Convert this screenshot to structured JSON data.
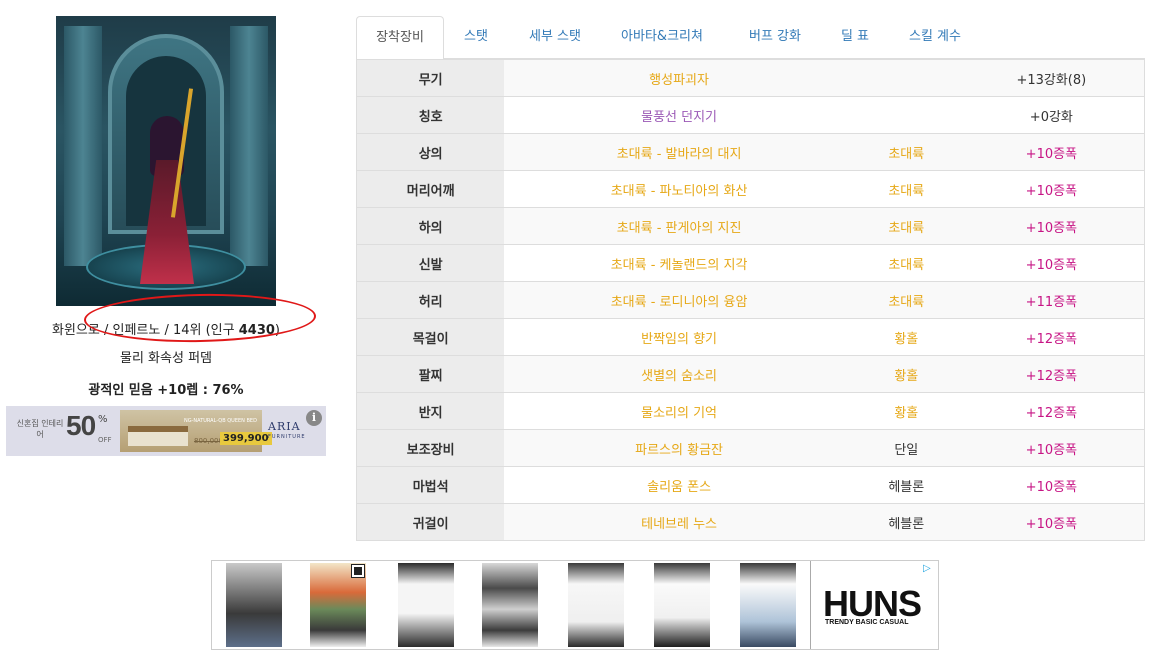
{
  "character": {
    "line1_prefix": "화윈으로 / 인페르노 / 14위 (인구 ",
    "line1_count": "4430",
    "line1_suffix": ")",
    "line2": "물리 화속성 퍼뎀",
    "line3": "광적인 믿음 +10렙 : 76%"
  },
  "tabs": [
    {
      "label": "장착장비",
      "active": true
    },
    {
      "label": "스탯",
      "active": false
    },
    {
      "label": "세부 스탯",
      "active": false
    },
    {
      "label": "아바타&크리쳐",
      "active": false
    },
    {
      "label": "버프 강화",
      "active": false
    },
    {
      "label": "딜 표",
      "active": false
    },
    {
      "label": "스킬 계수",
      "active": false
    }
  ],
  "equipment": [
    {
      "slot": "무기",
      "name": "행성파괴자",
      "grade": "",
      "enhance": "+13강화(8)",
      "name_color": "#e6a817",
      "grade_color": "#333333",
      "enhance_color": "#333333"
    },
    {
      "slot": "칭호",
      "name": "물풍선 던지기",
      "grade": "",
      "enhance": "+0강화",
      "name_color": "#9b59b6",
      "grade_color": "#333333",
      "enhance_color": "#333333"
    },
    {
      "slot": "상의",
      "name": "초대륙 - 발바라의 대지",
      "grade": "초대륙",
      "enhance": "+10증폭",
      "name_color": "#e6a817",
      "grade_color": "#e6a817",
      "enhance_color": "#c71585"
    },
    {
      "slot": "머리어깨",
      "name": "초대륙 - 파노티아의 화산",
      "grade": "초대륙",
      "enhance": "+10증폭",
      "name_color": "#e6a817",
      "grade_color": "#e6a817",
      "enhance_color": "#c71585"
    },
    {
      "slot": "하의",
      "name": "초대륙 - 판게아의 지진",
      "grade": "초대륙",
      "enhance": "+10증폭",
      "name_color": "#e6a817",
      "grade_color": "#e6a817",
      "enhance_color": "#c71585"
    },
    {
      "slot": "신발",
      "name": "초대륙 - 케놀랜드의 지각",
      "grade": "초대륙",
      "enhance": "+10증폭",
      "name_color": "#e6a817",
      "grade_color": "#e6a817",
      "enhance_color": "#c71585"
    },
    {
      "slot": "허리",
      "name": "초대륙 - 로디니아의 융암",
      "grade": "초대륙",
      "enhance": "+11증폭",
      "name_color": "#e6a817",
      "grade_color": "#e6a817",
      "enhance_color": "#c71585"
    },
    {
      "slot": "목걸이",
      "name": "반짝임의 향기",
      "grade": "황홀",
      "enhance": "+12증폭",
      "name_color": "#e6a817",
      "grade_color": "#e6a817",
      "enhance_color": "#c71585"
    },
    {
      "slot": "팔찌",
      "name": "샛별의 숨소리",
      "grade": "황홀",
      "enhance": "+12증폭",
      "name_color": "#e6a817",
      "grade_color": "#e6a817",
      "enhance_color": "#c71585"
    },
    {
      "slot": "반지",
      "name": "물소리의 기억",
      "grade": "황홀",
      "enhance": "+12증폭",
      "name_color": "#e6a817",
      "grade_color": "#e6a817",
      "enhance_color": "#c71585"
    },
    {
      "slot": "보조장비",
      "name": "파르스의 황금잔",
      "grade": "단일",
      "enhance": "+10증폭",
      "name_color": "#e6a817",
      "grade_color": "#333333",
      "enhance_color": "#c71585"
    },
    {
      "slot": "마법석",
      "name": "솔리움 폰스",
      "grade": "헤블론",
      "enhance": "+10증폭",
      "name_color": "#e6a817",
      "grade_color": "#333333",
      "enhance_color": "#c71585"
    },
    {
      "slot": "귀걸이",
      "name": "테네브레 누스",
      "grade": "헤블론",
      "enhance": "+10증폭",
      "name_color": "#e6a817",
      "grade_color": "#333333",
      "enhance_color": "#c71585"
    }
  ],
  "ad_left": {
    "small_text": "신혼집 인테리어",
    "percent": "50",
    "percent_sign": "%",
    "off": "OFF",
    "product_tag": "NG-NATURAL-QB QUEEN BED",
    "price_old": "800,000",
    "price": "399,900",
    "brand": "ARIA",
    "brand_sub": "FURNITURE",
    "info_icon": "info-icon"
  },
  "ad_bottom": {
    "brand": "HUNS",
    "tagline": "TRENDY BASIC CASUAL",
    "adchoices_icon": "adchoices-icon"
  }
}
